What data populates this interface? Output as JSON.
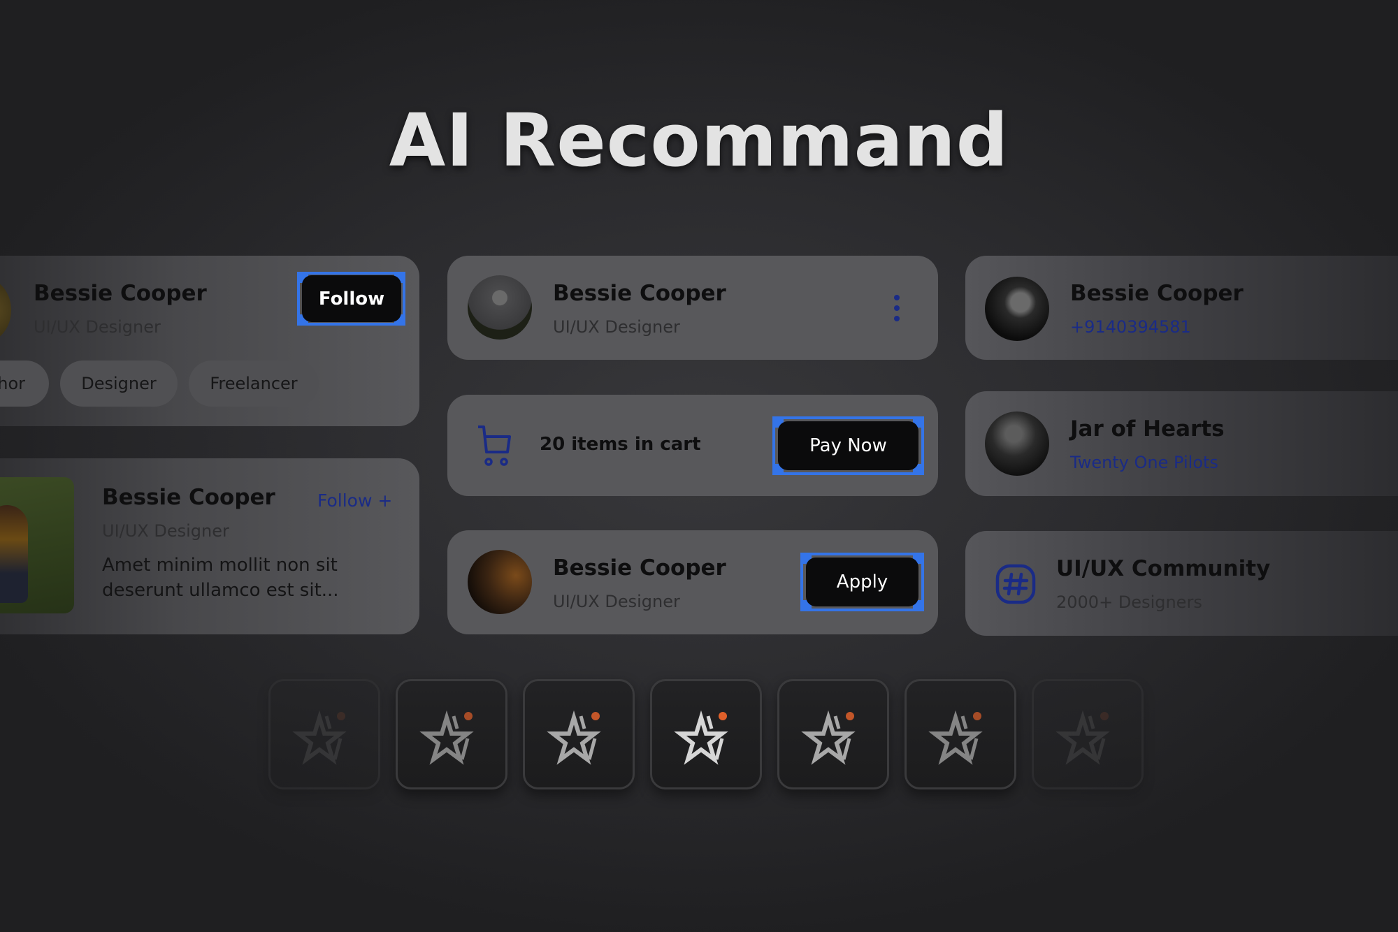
{
  "title": "AI Recommand",
  "colors": {
    "accent_blue": "#1a2b86",
    "focus_blue": "#3474e8",
    "badge_orange": "#e0602a"
  },
  "left_column": {
    "follow_card": {
      "name": "Bessie Cooper",
      "role": "UI/UX Designer",
      "button": "Follow",
      "tags": [
        "hor",
        "Designer",
        "Freelancer"
      ]
    },
    "post_card": {
      "name": "Bessie Cooper",
      "role": "UI/UX Designer",
      "follow_link": "Follow +",
      "description_line1": "Amet minim mollit non sit",
      "description_line2": "deserunt ullamco est sit..."
    }
  },
  "middle_column": {
    "profile_card": {
      "name": "Bessie Cooper",
      "role": "UI/UX Designer",
      "menu_icon": "more-vertical-icon"
    },
    "cart_card": {
      "icon": "cart-icon",
      "text": "20 items in cart",
      "button": "Pay Now"
    },
    "apply_card": {
      "name": "Bessie Cooper",
      "role": "UI/UX Designer",
      "button": "Apply"
    }
  },
  "right_column": {
    "contact_card": {
      "name": "Bessie Cooper",
      "phone": "+9140394581"
    },
    "music_card": {
      "title": "Jar of Hearts",
      "artist": "Twenty One Pilots"
    },
    "community_card": {
      "icon": "hashtag-icon",
      "name": "UI/UX Community",
      "members": "2000+ Designers"
    }
  },
  "icon_row": {
    "icon": "ai-star-icon",
    "count": 7,
    "selected_index": 3
  }
}
